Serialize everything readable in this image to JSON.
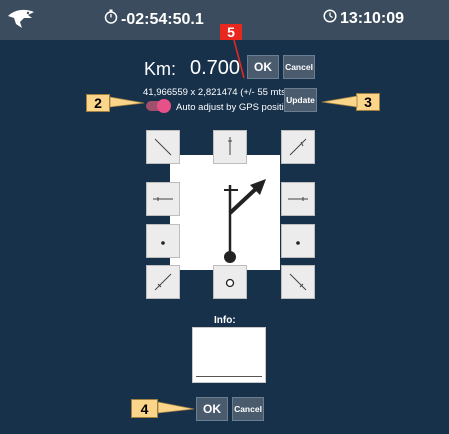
{
  "header": {
    "logo_icon": "eagle-logo-icon",
    "timer_icon": "stopwatch-icon",
    "timer_value": "-02:54:50.1",
    "clock_icon": "clock-icon",
    "clock_value": "13:10:09"
  },
  "km": {
    "label": "Km:",
    "value": "0.700",
    "ok_label": "OK",
    "cancel_label": "Cancel"
  },
  "gps": {
    "coordinates": "41,966559 x 2,821474 (+/- 55 mts)",
    "auto_adjust_label": "Auto adjust by GPS position",
    "auto_adjust_on": true,
    "update_label": "Update"
  },
  "direction_tiles": [
    "straight-left-diagonal-up",
    "straight-up",
    "straight-right-diagonal-up",
    "turn-left",
    "turn-right",
    "dot-left",
    "dot-right",
    "diagonal-left-down",
    "roundabout",
    "diagonal-right-down"
  ],
  "info": {
    "label": "Info:",
    "ok_label": "OK",
    "cancel_label": "Cancel"
  },
  "callouts": {
    "c2": "2",
    "c3": "3",
    "c4": "4",
    "c5": "5"
  },
  "colors": {
    "background": "#17314b",
    "topbar": "#3a4c5e",
    "button": "#4a5b6e",
    "callout": "#fbd58a",
    "callout_red": "#e8281e",
    "toggle_on": "#e8508a"
  }
}
